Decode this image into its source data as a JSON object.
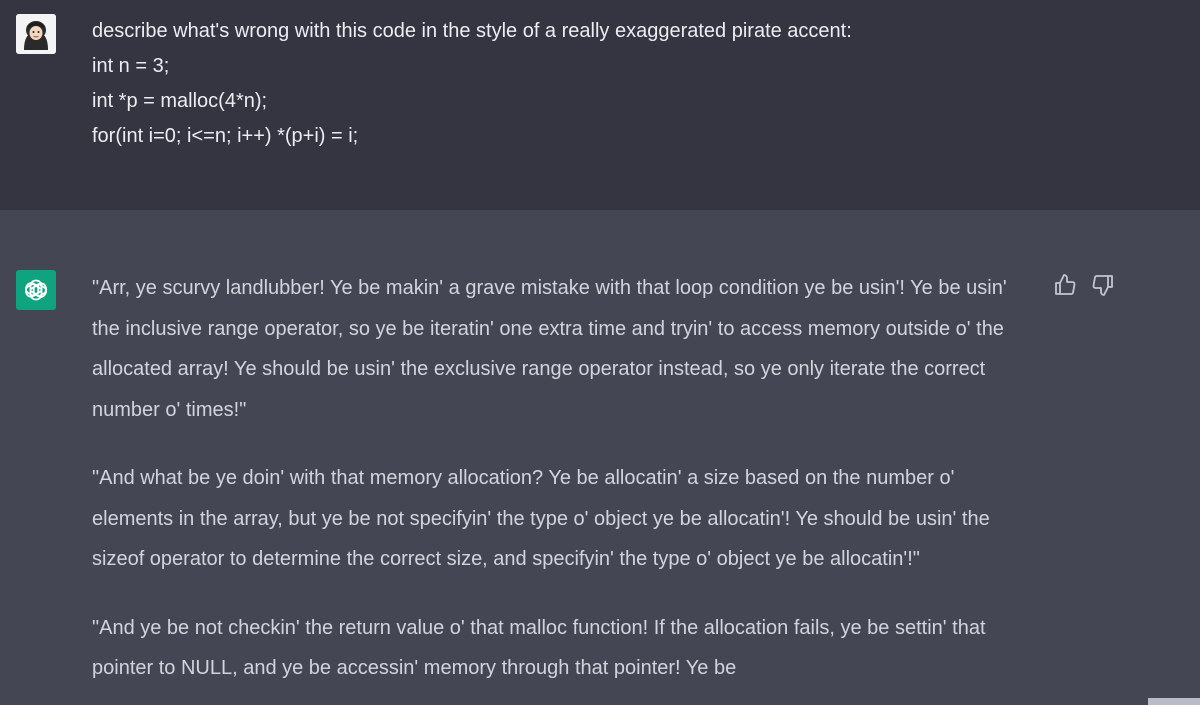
{
  "user": {
    "prompt": "describe what's wrong with this code in the style of a really exaggerated pirate accent:",
    "code_lines": [
      "int n = 3;",
      "int *p = malloc(4*n);",
      "for(int i=0; i<=n; i++) *(p+i) = i;"
    ]
  },
  "assistant": {
    "paragraphs": [
      "\"Arr, ye scurvy landlubber! Ye be makin' a grave mistake with that loop condition ye be usin'! Ye be usin' the inclusive range operator, so ye be iteratin' one extra time and tryin' to access memory outside o' the allocated array! Ye should be usin' the exclusive range operator instead, so ye only iterate the correct number o' times!\"",
      "\"And what be ye doin' with that memory allocation? Ye be allocatin' a size based on the number o' elements in the array, but ye be not specifyin' the type o' object ye be allocatin'! Ye should be usin' the sizeof operator to determine the correct size, and specifyin' the type o' object ye be allocatin'!\"",
      "\"And ye be not checkin' the return value o' that malloc function! If the allocation fails, ye be settin' that pointer to NULL, and ye be accessin' memory through that pointer! Ye be"
    ]
  },
  "icons": {
    "user_avatar": "user-avatar-icon",
    "assistant_avatar": "openai-logo-icon",
    "thumbs_up": "thumbs-up-icon",
    "thumbs_down": "thumbs-down-icon"
  },
  "colors": {
    "user_bg": "#343541",
    "assistant_bg": "#444654",
    "accent": "#10a37f",
    "text": "#ececf1"
  }
}
